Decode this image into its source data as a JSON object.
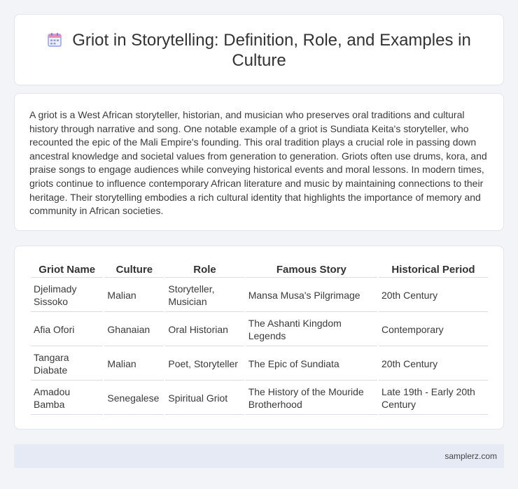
{
  "header": {
    "icon": "calendar-icon",
    "title": "Griot in Storytelling: Definition, Role, and Examples in Culture"
  },
  "description": "A griot is a West African storyteller, historian, and musician who preserves oral traditions and cultural history through narrative and song. One notable example of a griot is Sundiata Keita's storyteller, who recounted the epic of the Mali Empire's founding. This oral tradition plays a crucial role in passing down ancestral knowledge and societal values from generation to generation. Griots often use drums, kora, and praise songs to engage audiences while conveying historical events and moral lessons. In modern times, griots continue to influence contemporary African literature and music by maintaining connections to their heritage. Their storytelling embodies a rich cultural identity that highlights the importance of memory and community in African societies.",
  "table": {
    "headers": [
      "Griot Name",
      "Culture",
      "Role",
      "Famous Story",
      "Historical Period"
    ],
    "rows": [
      [
        "Djelimady Sissoko",
        "Malian",
        "Storyteller, Musician",
        "Mansa Musa's Pilgrimage",
        "20th Century"
      ],
      [
        "Afia Ofori",
        "Ghanaian",
        "Oral Historian",
        "The Ashanti Kingdom Legends",
        "Contemporary"
      ],
      [
        "Tangara Diabate",
        "Malian",
        "Poet, Storyteller",
        "The Epic of Sundiata",
        "20th Century"
      ],
      [
        "Amadou Bamba",
        "Senegalese",
        "Spiritual Griot",
        "The History of the Mouride Brotherhood",
        "Late 19th - Early 20th Century"
      ]
    ]
  },
  "footer": {
    "text": "samplerz.com"
  },
  "colors": {
    "background": "#f3f4f8",
    "card": "#ffffff",
    "footer": "#e6eaf5",
    "icon_accent": "#6d7fe0"
  }
}
